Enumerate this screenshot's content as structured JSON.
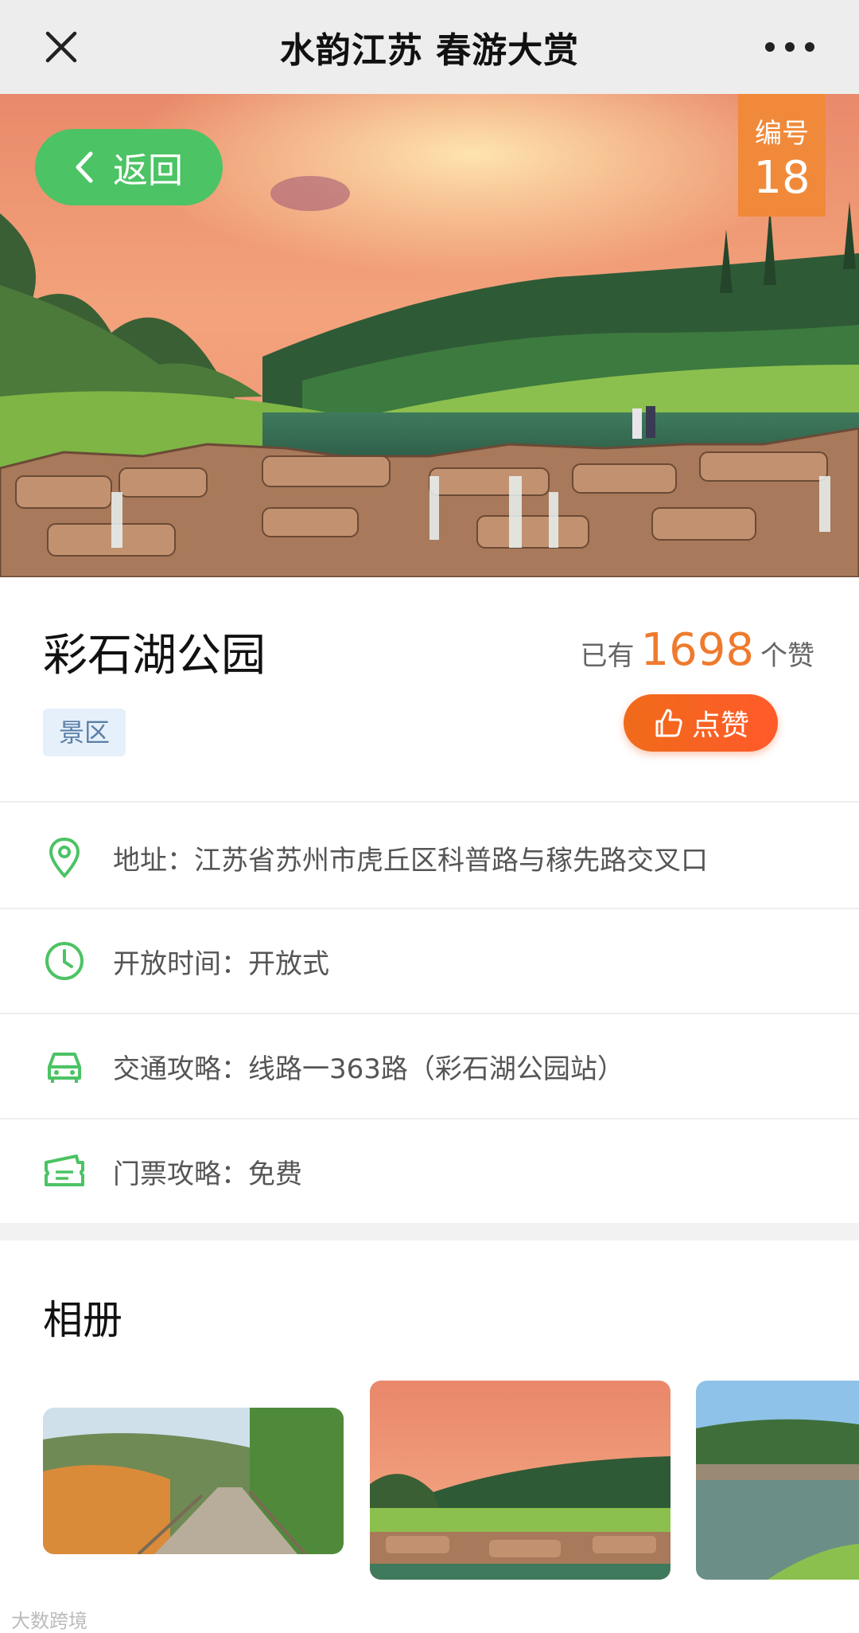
{
  "nav": {
    "title": "水韵江苏 春游大赏",
    "close_icon": "close-icon",
    "more_icon": "more-icon"
  },
  "hero": {
    "back_label": "返回",
    "number_label": "编号",
    "number_value": "18"
  },
  "place": {
    "name": "彩石湖公园",
    "likes_prefix": "已有",
    "likes_count": "1698",
    "likes_suffix": "个赞",
    "tag": "景区",
    "like_button": "点赞"
  },
  "info": [
    {
      "icon": "location-pin-icon",
      "text": "地址：江苏省苏州市虎丘区科普路与稼先路交叉口"
    },
    {
      "icon": "clock-icon",
      "text": "开放时间：开放式"
    },
    {
      "icon": "car-icon",
      "text": "交通攻略：线路一363路（彩石湖公园站）"
    },
    {
      "icon": "ticket-icon",
      "text": "门票攻略：免费"
    }
  ],
  "album": {
    "title": "相册"
  },
  "watermark": "大数跨境",
  "colors": {
    "green": "#4cc364",
    "orange": "#ef7a2e",
    "tag_bg": "#e6f0fb"
  }
}
